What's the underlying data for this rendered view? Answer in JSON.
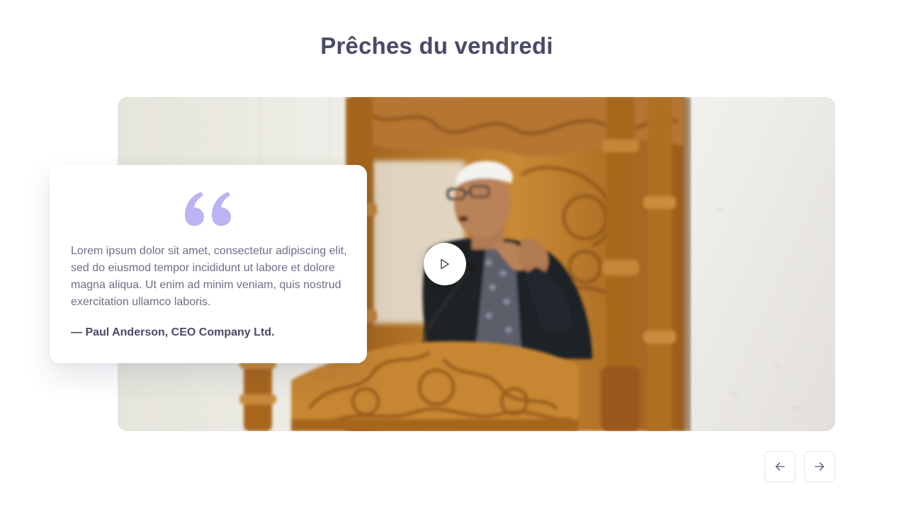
{
  "section": {
    "title": "Prêches du vendredi"
  },
  "testimonial": {
    "quote_icon": "quote-icon",
    "text": "Lorem ipsum dolor sit amet, consectetur adipiscing elit, sed do eiusmod tempor incididunt ut labore et dolore magna aliqua. Ut enim ad minim veniam, quis nostrud exercitation ullamco laboris.",
    "author": "— Paul Anderson, CEO Company Ltd."
  },
  "video": {
    "play_icon": "play-icon"
  },
  "navigation": {
    "prev_icon": "arrow-left-icon",
    "next_icon": "arrow-right-icon"
  },
  "colors": {
    "heading": "#4a4a68",
    "body_text": "#6e6e8a",
    "accent": "#b9b4f2",
    "border": "#e4e4ee"
  }
}
